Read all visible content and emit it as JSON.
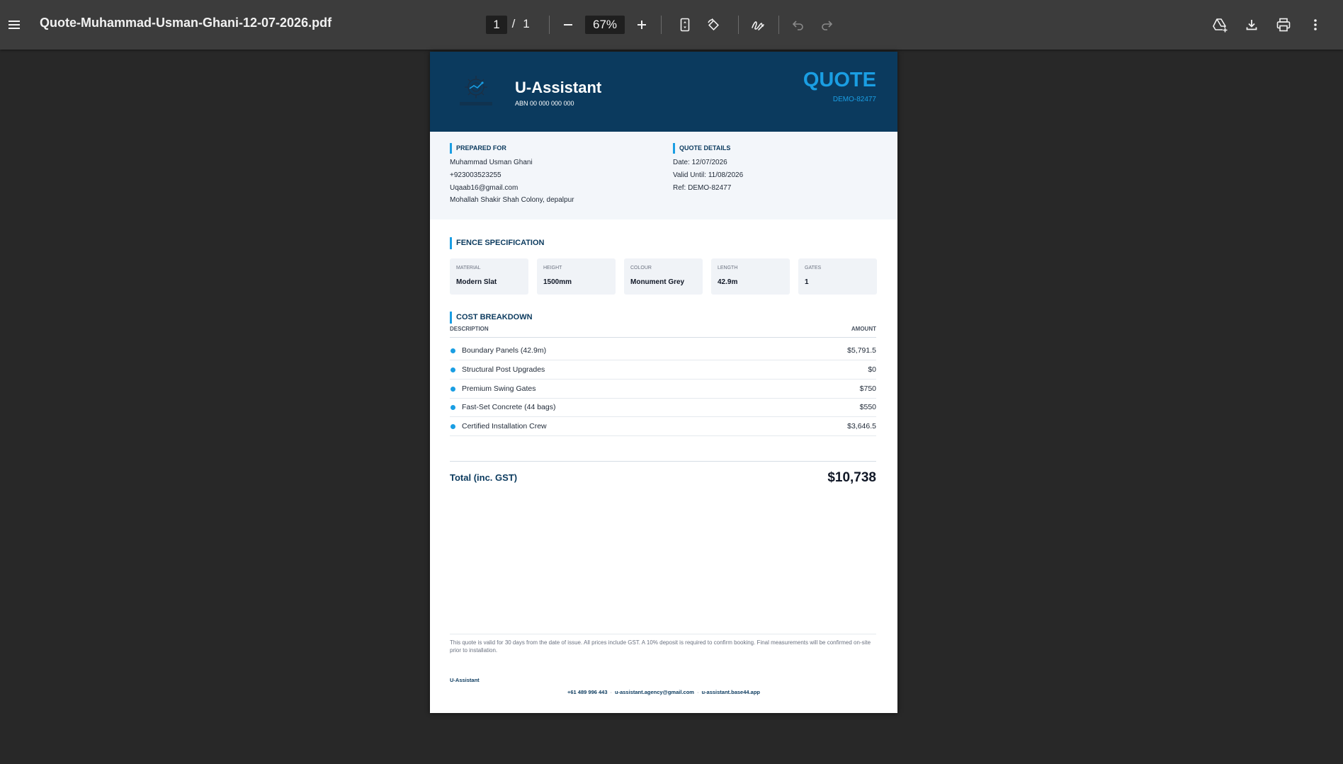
{
  "viewer": {
    "file_name": "Quote-Muhammad-Usman-Ghani-12-07-2026.pdf",
    "current_page": "1",
    "page_separator": "/",
    "total_pages": "1",
    "zoom": "67%",
    "icons": {
      "menu": "menu-icon",
      "zoom_out": "minus-icon",
      "zoom_in": "plus-icon",
      "fit": "fit-page-icon",
      "rotate": "rotate-icon",
      "annotate": "draw-icon",
      "undo": "undo-icon",
      "redo": "redo-icon",
      "drive": "add-to-drive-icon",
      "download": "download-icon",
      "print": "print-icon",
      "more": "more-vert-icon"
    }
  },
  "document": {
    "header": {
      "company_name": "U-Assistant",
      "abn": "ABN 00 000 000 000",
      "doc_type": "QUOTE",
      "quote_id": "DEMO-82477",
      "logo_text": "U-ASSISTANT"
    },
    "prepared_for": {
      "title": "PREPARED FOR",
      "name": "Muhammad Usman Ghani",
      "phone": "+923003523255",
      "email": "Uqaab16@gmail.com",
      "address": "Mohallah Shakir Shah Colony, depalpur"
    },
    "quote_details": {
      "title": "QUOTE DETAILS",
      "date": "Date: 12/07/2026",
      "valid_until": "Valid Until: 11/08/2026",
      "ref": "Ref: DEMO-82477"
    },
    "fence_spec": {
      "title": "FENCE SPECIFICATION",
      "items": [
        {
          "label": "MATERIAL",
          "value": "Modern Slat"
        },
        {
          "label": "HEIGHT",
          "value": "1500mm"
        },
        {
          "label": "COLOUR",
          "value": "Monument Grey"
        },
        {
          "label": "LENGTH",
          "value": "42.9m"
        },
        {
          "label": "GATES",
          "value": "1"
        }
      ]
    },
    "cost_breakdown": {
      "title": "COST BREAKDOWN",
      "col_description": "DESCRIPTION",
      "col_amount": "AMOUNT",
      "rows": [
        {
          "description": "Boundary Panels (42.9m)",
          "amount": "$5,791.5"
        },
        {
          "description": "Structural Post Upgrades",
          "amount": "$0"
        },
        {
          "description": "Premium Swing Gates",
          "amount": "$750"
        },
        {
          "description": "Fast-Set Concrete (44 bags)",
          "amount": "$550"
        },
        {
          "description": "Certified Installation Crew",
          "amount": "$3,646.5"
        }
      ]
    },
    "total": {
      "label": "Total (inc. GST)",
      "value": "$10,738"
    },
    "terms": "This quote is valid for 30 days from the date of issue. All prices include GST. A 10% deposit is required to confirm booking. Final measurements will be confirmed on-site prior to installation.",
    "footer": {
      "company": "U-Assistant",
      "phone": "+61 489 996 443",
      "email": "u-assistant.agency@gmail.com",
      "website": "u-assistant.base44.app",
      "separator": "·"
    },
    "colors": {
      "header_navy": "#0b3a5e",
      "accent_blue": "#1a9ee3",
      "info_band": "#f3f6fa"
    }
  }
}
